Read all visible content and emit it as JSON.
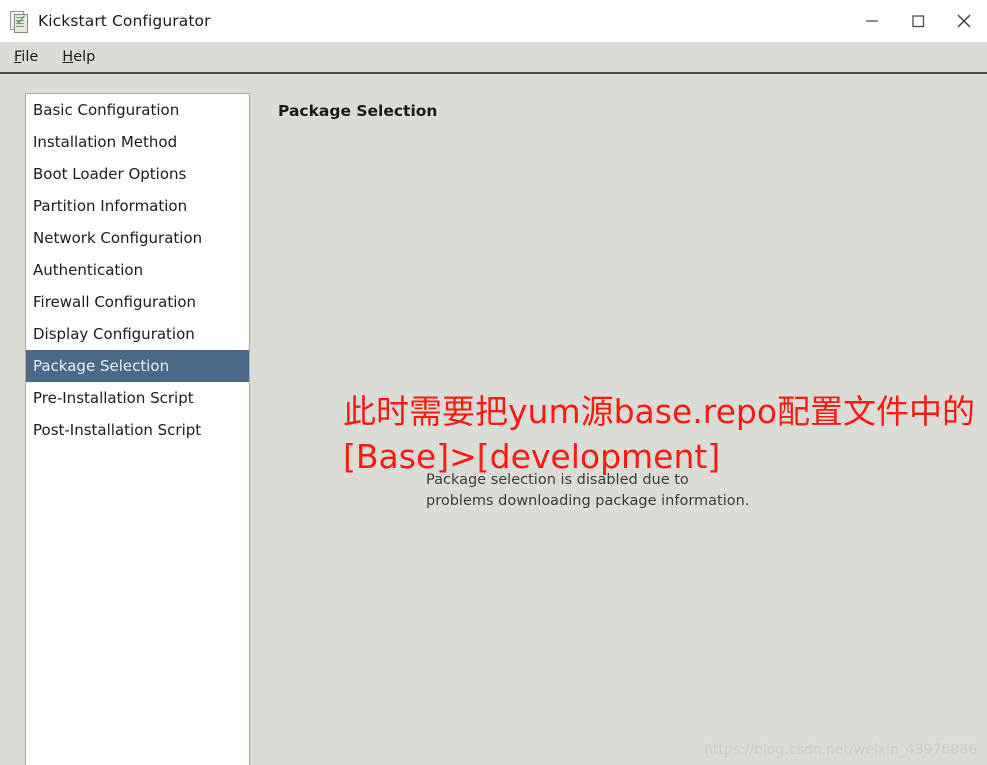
{
  "window": {
    "title": "Kickstart Configurator",
    "icon": "kickstart-app-icon",
    "controls": {
      "minimize": "minimize-icon",
      "maximize": "maximize-icon",
      "close": "close-icon"
    }
  },
  "menubar": {
    "items": [
      {
        "label": "File",
        "mnemonic": "F",
        "rest": "ile"
      },
      {
        "label": "Help",
        "mnemonic": "H",
        "rest": "elp"
      }
    ]
  },
  "sidebar": {
    "selected_index": 8,
    "items": [
      {
        "label": "Basic Configuration"
      },
      {
        "label": "Installation Method"
      },
      {
        "label": "Boot Loader Options"
      },
      {
        "label": "Partition Information"
      },
      {
        "label": "Network Configuration"
      },
      {
        "label": "Authentication"
      },
      {
        "label": "Firewall Configuration"
      },
      {
        "label": "Display Configuration"
      },
      {
        "label": "Package Selection"
      },
      {
        "label": "Pre-Installation Script"
      },
      {
        "label": "Post-Installation Script"
      }
    ]
  },
  "main": {
    "title": "Package Selection",
    "message_line1": "Package selection is disabled due to",
    "message_line2": "problems downloading package information."
  },
  "annotation": {
    "color": "#fb1b12",
    "line1": "此时需要把yum源base.repo配置文件中的",
    "line2": "[Base]>[development]"
  },
  "watermark": {
    "text": "https://blog.csdn.net/weixin_43976886"
  },
  "colors": {
    "window_background": "#dcdcd7",
    "titlebar_background": "#ffffff",
    "list_background": "#ffffff",
    "selection": "#4a6a88",
    "selection_text": "#e9eef3",
    "annotation_red": "#fb1b12",
    "watermark_gray": "#cbcbc5"
  }
}
